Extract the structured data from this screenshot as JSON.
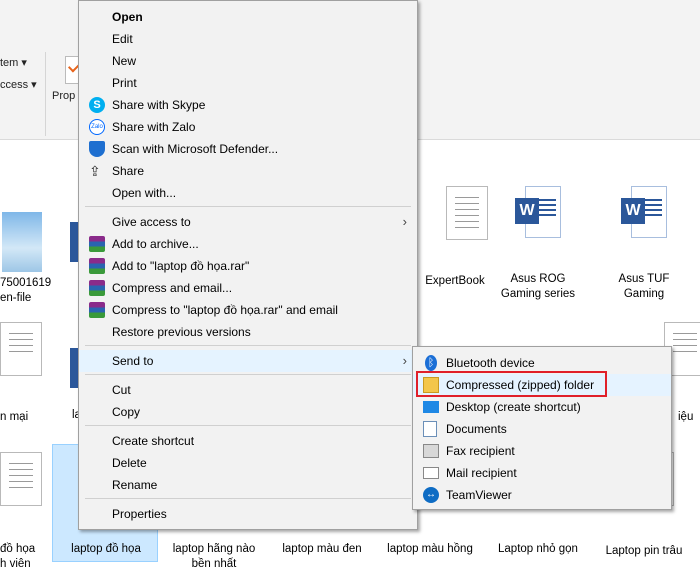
{
  "ribbon": {
    "item_partial": "tem ▾",
    "access_partial": "ccess ▾",
    "properties_partial": "Prop"
  },
  "files": [
    {
      "name1": "75001619",
      "name2": "en-file"
    },
    {
      "name1": "ExpertBook",
      "name2": ""
    },
    {
      "name1": "Asus ROG",
      "name2": "Gaming series"
    },
    {
      "name1": "Asus TUF",
      "name2": "Gaming"
    },
    {
      "name1": "n mại",
      "name2": ""
    },
    {
      "name1": "la",
      "name2": ""
    },
    {
      "name1": "iệu",
      "name2": ""
    },
    {
      "name1": "đồ họa",
      "name2": "h viên"
    },
    {
      "name1": "laptop đồ họa",
      "name2": ""
    },
    {
      "name1": "laptop hãng nào",
      "name2": "bền nhất"
    },
    {
      "name1": "laptop màu đen",
      "name2": ""
    },
    {
      "name1": "laptop màu hồng",
      "name2": ""
    },
    {
      "name1": "Laptop nhỏ gọn",
      "name2": ""
    },
    {
      "name1": "Laptop pin trâu",
      "name2": ""
    }
  ],
  "context_menu": {
    "open": "Open",
    "edit": "Edit",
    "new": "New",
    "print": "Print",
    "share_skype": "Share with Skype",
    "share_zalo": "Share with Zalo",
    "scan_defender": "Scan with Microsoft Defender...",
    "share": "Share",
    "open_with": "Open with...",
    "give_access": "Give access to",
    "add_archive": "Add to archive...",
    "add_rar": "Add to \"laptop đồ họa.rar\"",
    "compress_email": "Compress and email...",
    "compress_rar_email": "Compress to \"laptop đồ họa.rar\" and email",
    "restore_versions": "Restore previous versions",
    "send_to": "Send to",
    "cut": "Cut",
    "copy": "Copy",
    "create_shortcut": "Create shortcut",
    "delete": "Delete",
    "rename": "Rename",
    "properties": "Properties",
    "zalo_icon_text": "Zalo"
  },
  "send_to_menu": {
    "bluetooth": "Bluetooth device",
    "compressed": "Compressed (zipped) folder",
    "desktop": "Desktop (create shortcut)",
    "documents": "Documents",
    "fax": "Fax recipient",
    "mail": "Mail recipient",
    "teamviewer": "TeamViewer"
  },
  "icons": {
    "word_letter": "W",
    "arrow": "›"
  },
  "colors": {
    "highlight": "#e5f3ff",
    "red_box": "#e0202a",
    "word_blue": "#2b579a",
    "selection": "#cce8ff"
  }
}
